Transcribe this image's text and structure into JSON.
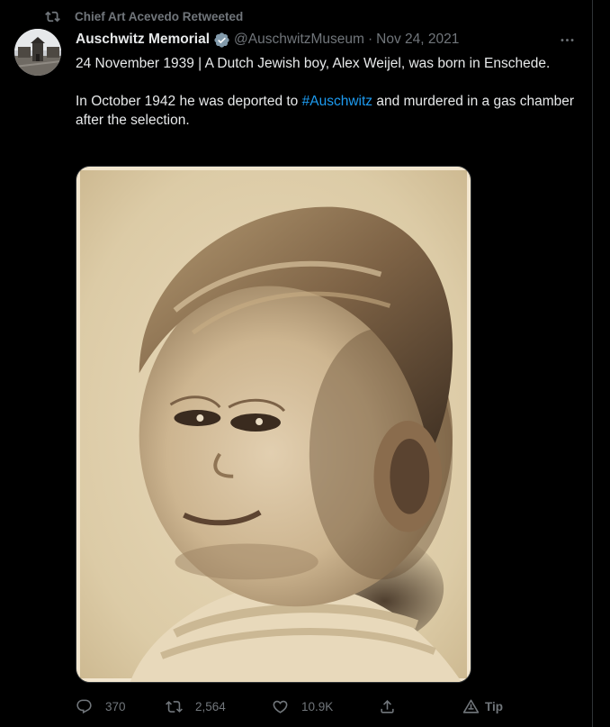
{
  "retweet": {
    "icon": "retweet-icon",
    "label": "Chief Art Acevedo Retweeted"
  },
  "author": {
    "avatar": "avatar-image",
    "display_name": "Auschwitz Memorial",
    "verified_icon": "verified-badge-icon",
    "handle": "@AuschwitzMuseum",
    "separator": "·",
    "date": "Nov 24, 2021"
  },
  "more_icon": "more-icon",
  "body": {
    "para1": "24 November 1939 | A Dutch Jewish boy, Alex Weijel, was born in Enschede.",
    "para2_before": "In October 1942 he was deported to ",
    "hashtag": "#Auschwitz",
    "para2_after": " and murdered in a gas chamber after the selection."
  },
  "media": {
    "kind": "sepia portrait photograph"
  },
  "actions": {
    "reply": {
      "icon": "reply-icon",
      "count": "370"
    },
    "retweet": {
      "icon": "retweet-icon",
      "count": "2,564"
    },
    "like": {
      "icon": "heart-icon",
      "count": "10.9K"
    },
    "share": {
      "icon": "share-icon"
    },
    "tip": {
      "icon": "tip-icon",
      "label": "Tip"
    }
  },
  "colors": {
    "background": "#000000",
    "text": "#e7e9ea",
    "muted": "#71767b",
    "link": "#1d9bf0",
    "verified": "#829aab"
  }
}
